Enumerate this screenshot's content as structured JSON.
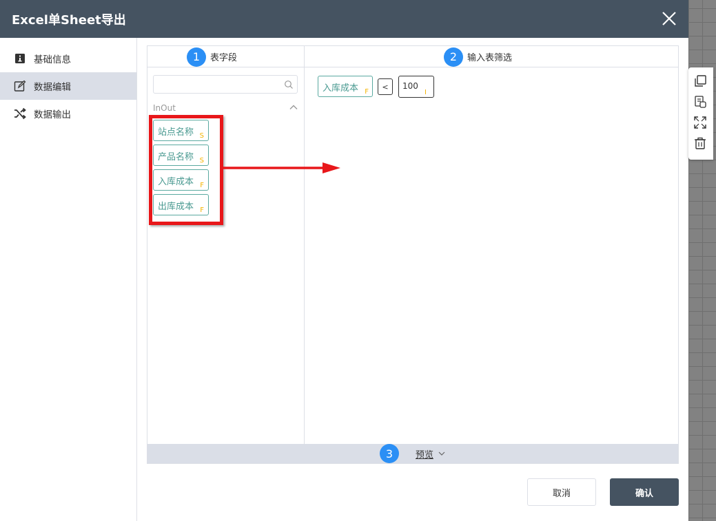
{
  "dialog": {
    "title": "Excel单Sheet导出"
  },
  "sidebar": {
    "items": [
      {
        "label": "基础信息",
        "icon": "info-icon"
      },
      {
        "label": "数据编辑",
        "icon": "edit-icon",
        "active": true
      },
      {
        "label": "数据输出",
        "icon": "shuffle-icon"
      }
    ]
  },
  "columns": {
    "left": {
      "badge": "1",
      "title": "表字段"
    },
    "right": {
      "badge": "2",
      "title": "输入表筛选"
    }
  },
  "search": {
    "value": "",
    "placeholder": ""
  },
  "group": {
    "label": "InOut"
  },
  "fields": [
    {
      "label": "站点名称",
      "type": "S"
    },
    {
      "label": "产品名称",
      "type": "S"
    },
    {
      "label": "入库成本",
      "type": "F"
    },
    {
      "label": "出库成本",
      "type": "F"
    }
  ],
  "filter": {
    "field": {
      "label": "入库成本",
      "type": "F"
    },
    "operator": "<",
    "value": {
      "text": "100",
      "type": "I"
    }
  },
  "preview": {
    "badge": "3",
    "label": "预览"
  },
  "buttons": {
    "cancel": "取消",
    "confirm": "确认"
  },
  "colors": {
    "header": "#455361",
    "badge": "#2b8ff5",
    "chip_border": "#5aa9a0",
    "type_letter": "#f5b400",
    "annotation": "#e8171a"
  }
}
